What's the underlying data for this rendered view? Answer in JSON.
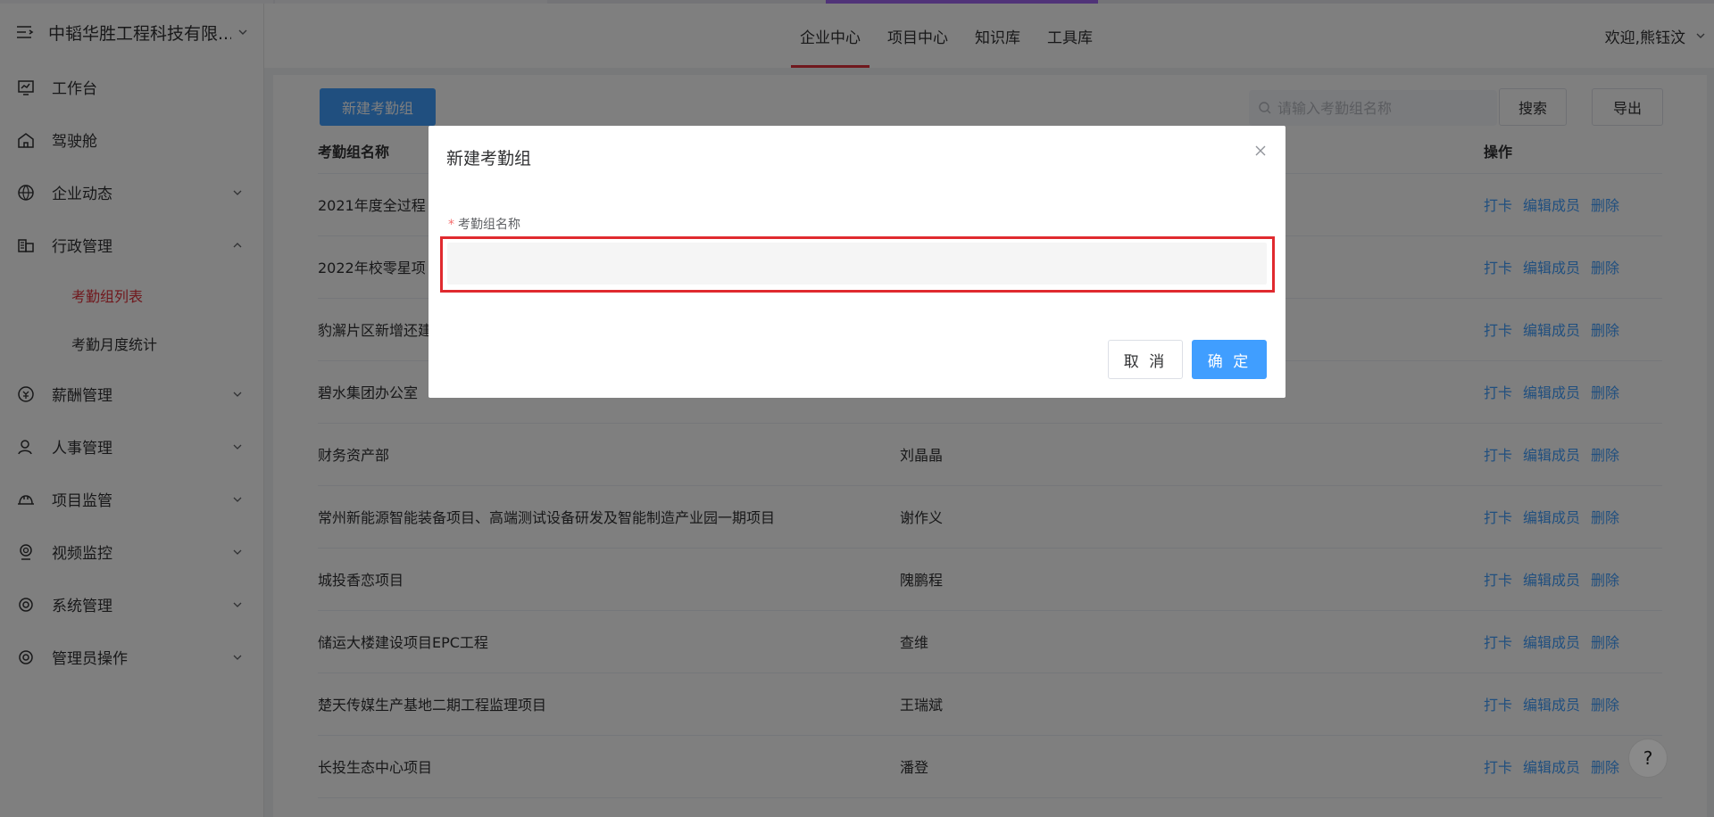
{
  "company": {
    "name": "中韬华胜工程科技有限..."
  },
  "colors": {
    "accent": "#409eff",
    "active_red": "#e0303a",
    "strip_purple": "#a066f0"
  },
  "sidebar": {
    "items": [
      {
        "label": "工作台",
        "icon": "monitor-icon"
      },
      {
        "label": "驾驶舱",
        "icon": "home-icon"
      },
      {
        "label": "企业动态",
        "icon": "globe-icon"
      },
      {
        "label": "行政管理",
        "icon": "building-icon"
      },
      {
        "label": "薪酬管理",
        "icon": "coin-icon"
      },
      {
        "label": "人事管理",
        "icon": "person-icon"
      },
      {
        "label": "项目监管",
        "icon": "helmet-icon"
      },
      {
        "label": "视频监控",
        "icon": "camera-icon"
      },
      {
        "label": "系统管理",
        "icon": "settings-icon"
      },
      {
        "label": "管理员操作",
        "icon": "admin-icon"
      }
    ],
    "sub_items": [
      {
        "label": "考勤组列表"
      },
      {
        "label": "考勤月度统计"
      }
    ]
  },
  "header": {
    "tabs": [
      {
        "label": "企业中心"
      },
      {
        "label": "项目中心"
      },
      {
        "label": "知识库"
      },
      {
        "label": "工具库"
      }
    ],
    "user": "欢迎,熊钰汶"
  },
  "toolbar": {
    "new_label": "新建考勤组",
    "search_placeholder": "请输入考勤组名称",
    "search_label": "搜索",
    "export_label": "导出"
  },
  "table": {
    "headers": {
      "name": "考勤组名称",
      "ops": "操作"
    },
    "ops": {
      "clock": "打卡",
      "edit": "编辑成员",
      "delete": "删除"
    },
    "rows": [
      {
        "name": "2021年度全过程",
        "owner": ""
      },
      {
        "name": "2022年校零星项",
        "owner": ""
      },
      {
        "name": "豹澥片区新增还建",
        "owner": ""
      },
      {
        "name": "碧水集团办公室",
        "owner": ""
      },
      {
        "name": "财务资产部",
        "owner": "刘晶晶"
      },
      {
        "name": "常州新能源智能装备项目、高端测试设备研发及智能制造产业园一期项目",
        "owner": "谢作义"
      },
      {
        "name": "城投香恋项目",
        "owner": "隗鹏程"
      },
      {
        "name": "储运大楼建设项目EPC工程",
        "owner": "查维"
      },
      {
        "name": "楚天传媒生产基地二期工程监理项目",
        "owner": "王瑞斌"
      },
      {
        "name": "长投生态中心项目",
        "owner": "潘登"
      }
    ]
  },
  "dialog": {
    "title": "新建考勤组",
    "field_label": "考勤组名称",
    "required_mark": "*",
    "input_value": "",
    "cancel_label": "取 消",
    "ok_label": "确 定"
  },
  "help": {
    "label": "?"
  }
}
